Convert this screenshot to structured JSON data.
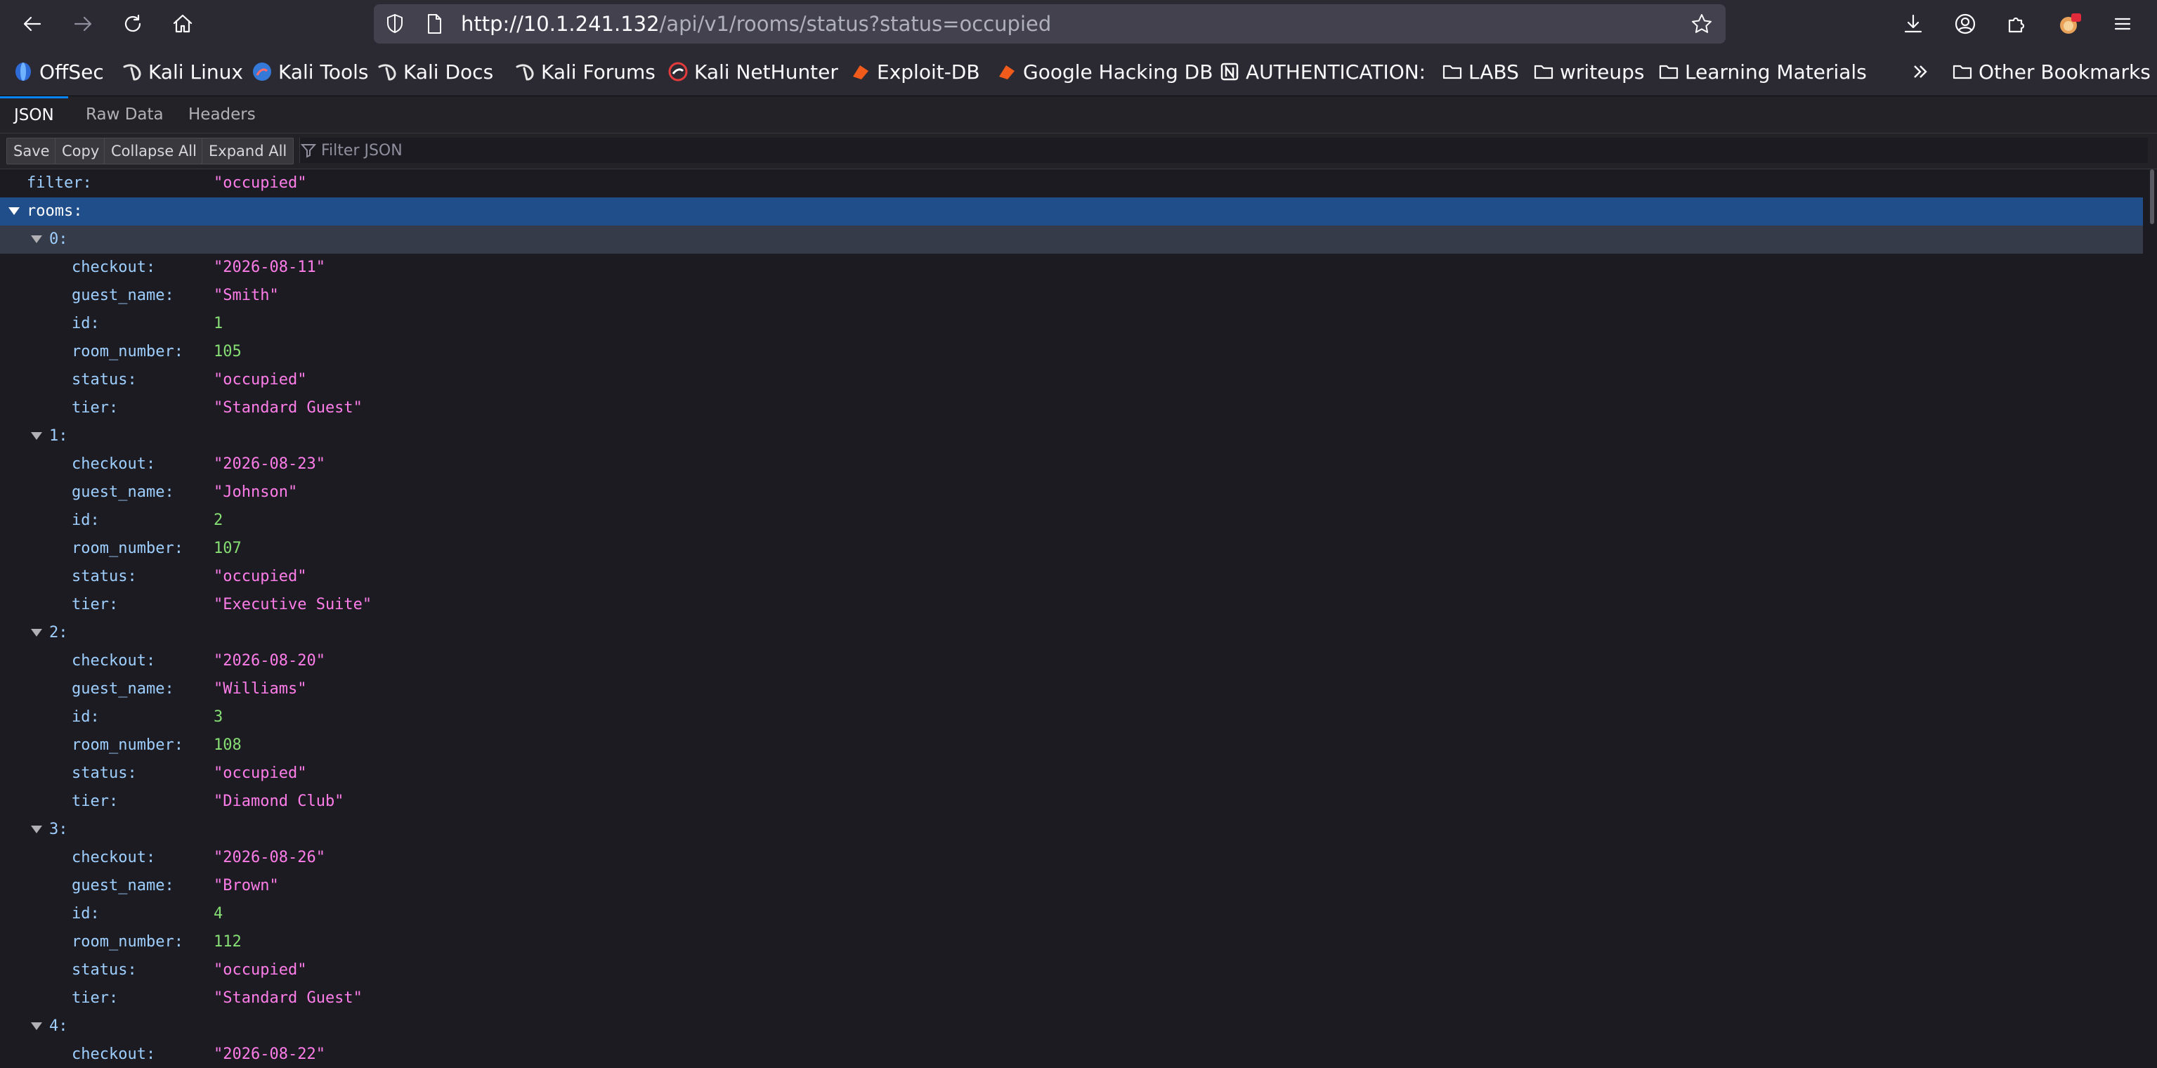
{
  "url": {
    "host": "http://10.1.241.132",
    "path": "/api/v1/rooms/status?status=occupied"
  },
  "bookmarks": [
    {
      "label": "OffSec",
      "icon": "offsec-icon",
      "color": "#2e6bd6"
    },
    {
      "label": "Kali Linux",
      "icon": "kali-dragon-icon",
      "color": "#e6e6e6"
    },
    {
      "label": "Kali Tools",
      "icon": "kali-tools-icon",
      "color": "#3478d8"
    },
    {
      "label": "Kali Docs",
      "icon": "kali-dragon-icon",
      "color": "#e6e6e6"
    },
    {
      "label": "Kali Forums",
      "icon": "kali-dragon-icon",
      "color": "#e6e6e6"
    },
    {
      "label": "Kali NetHunter",
      "icon": "nethunter-icon",
      "color": "#e33b3b"
    },
    {
      "label": "Exploit-DB",
      "icon": "exploit-db-icon",
      "color": "#f05a1a"
    },
    {
      "label": "Google Hacking DB",
      "icon": "ghdb-icon",
      "color": "#f05a1a"
    },
    {
      "label": "AUTHENTICATION:",
      "icon": "notion-icon",
      "color": "#ffffff"
    },
    {
      "label": "LABS",
      "icon": "folder-icon",
      "color": "#fbfbfe"
    },
    {
      "label": "writeups",
      "icon": "folder-icon",
      "color": "#fbfbfe"
    },
    {
      "label": "Learning Materials",
      "icon": "folder-icon",
      "color": "#fbfbfe"
    }
  ],
  "other_bookmarks": "Other Bookmarks",
  "viewer_tabs": [
    "JSON",
    "Raw Data",
    "Headers"
  ],
  "json_toolbar": {
    "save": "Save",
    "copy": "Copy",
    "collapse_all": "Collapse All",
    "expand_all": "Expand All",
    "filter_placeholder": "Filter JSON"
  },
  "json": {
    "filter": "\"occupied\"",
    "rooms_key": "rooms:",
    "rooms": [
      {
        "index": "0:",
        "fields": [
          {
            "k": "checkout:",
            "v": "\"2026-08-11\"",
            "t": "str"
          },
          {
            "k": "guest_name:",
            "v": "\"Smith\"",
            "t": "str"
          },
          {
            "k": "id:",
            "v": "1",
            "t": "num"
          },
          {
            "k": "room_number:",
            "v": "105",
            "t": "num"
          },
          {
            "k": "status:",
            "v": "\"occupied\"",
            "t": "str"
          },
          {
            "k": "tier:",
            "v": "\"Standard Guest\"",
            "t": "str"
          }
        ]
      },
      {
        "index": "1:",
        "fields": [
          {
            "k": "checkout:",
            "v": "\"2026-08-23\"",
            "t": "str"
          },
          {
            "k": "guest_name:",
            "v": "\"Johnson\"",
            "t": "str"
          },
          {
            "k": "id:",
            "v": "2",
            "t": "num"
          },
          {
            "k": "room_number:",
            "v": "107",
            "t": "num"
          },
          {
            "k": "status:",
            "v": "\"occupied\"",
            "t": "str"
          },
          {
            "k": "tier:",
            "v": "\"Executive Suite\"",
            "t": "str"
          }
        ]
      },
      {
        "index": "2:",
        "fields": [
          {
            "k": "checkout:",
            "v": "\"2026-08-20\"",
            "t": "str"
          },
          {
            "k": "guest_name:",
            "v": "\"Williams\"",
            "t": "str"
          },
          {
            "k": "id:",
            "v": "3",
            "t": "num"
          },
          {
            "k": "room_number:",
            "v": "108",
            "t": "num"
          },
          {
            "k": "status:",
            "v": "\"occupied\"",
            "t": "str"
          },
          {
            "k": "tier:",
            "v": "\"Diamond Club\"",
            "t": "str"
          }
        ]
      },
      {
        "index": "3:",
        "fields": [
          {
            "k": "checkout:",
            "v": "\"2026-08-26\"",
            "t": "str"
          },
          {
            "k": "guest_name:",
            "v": "\"Brown\"",
            "t": "str"
          },
          {
            "k": "id:",
            "v": "4",
            "t": "num"
          },
          {
            "k": "room_number:",
            "v": "112",
            "t": "num"
          },
          {
            "k": "status:",
            "v": "\"occupied\"",
            "t": "str"
          },
          {
            "k": "tier:",
            "v": "\"Standard Guest\"",
            "t": "str"
          }
        ]
      },
      {
        "index": "4:",
        "fields": [
          {
            "k": "checkout:",
            "v": "\"2026-08-22\"",
            "t": "str"
          }
        ]
      }
    ]
  }
}
